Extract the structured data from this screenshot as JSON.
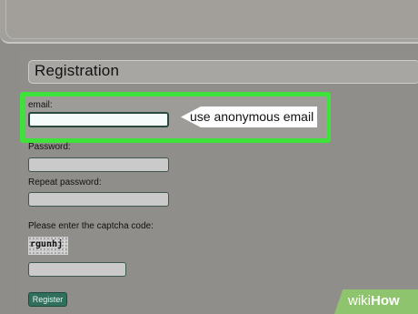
{
  "form": {
    "title": "Registration",
    "email_label": "email:",
    "email_value": "",
    "password_label": "Password:",
    "repeat_password_label": "Repeat password:",
    "captcha_label": "Please enter the captcha code:",
    "captcha_code": "rgunhj",
    "register_label": "Register"
  },
  "annotation": {
    "callout_text": "use anonymous email",
    "highlight_color": "#3ee23a"
  },
  "watermark": {
    "wiki": "wiki",
    "how": "How"
  },
  "colors": {
    "background": "#8f8d89",
    "button": "#2f6f5c",
    "watermark_bg": "#8fc46e"
  }
}
